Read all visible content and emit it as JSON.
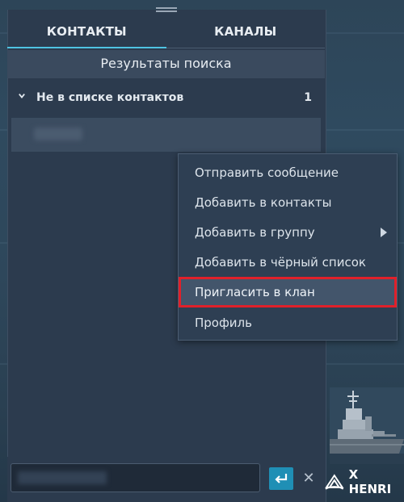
{
  "tabs": {
    "contacts": "КОНТАКТЫ",
    "channels": "КАНАЛЫ"
  },
  "search": {
    "results_title": "Результаты поиска"
  },
  "group": {
    "label": "Не в списке контактов",
    "count": "1"
  },
  "context_menu": {
    "items": [
      "Отправить сообщение",
      "Добавить в контакты",
      "Добавить в группу",
      "Добавить в чёрный список",
      "Пригласить в клан",
      "Профиль"
    ],
    "highlighted_item": "Пригласить в клан",
    "highlight_color": "#e0202a"
  },
  "chat_input": {
    "placeholder": ""
  },
  "clan_badge": {
    "label": "X HENRI"
  },
  "colors": {
    "accent": "#4fc3e2",
    "send_button": "#1f8fb5",
    "panel_bg": "#2c3b4e"
  },
  "icons": {
    "send": "enter-arrow-icon",
    "close": "close-icon",
    "expand": "chevron-down-icon",
    "submenu": "chevron-right-icon"
  }
}
